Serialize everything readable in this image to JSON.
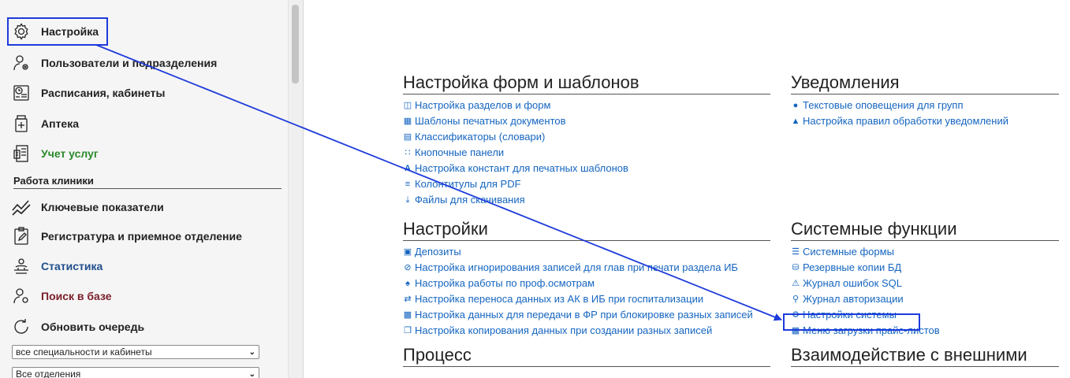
{
  "sidebar": {
    "items": [
      {
        "label": "Настройка"
      },
      {
        "label": "Пользователи и подразделения"
      },
      {
        "label": "Расписания, кабинеты"
      },
      {
        "label": "Аптека"
      },
      {
        "label": "Учет услуг"
      },
      {
        "label": "Ключевые показатели"
      },
      {
        "label": "Регистратура и приемное отделение"
      },
      {
        "label": "Статистика"
      },
      {
        "label": "Поиск в базе"
      },
      {
        "label": "Обновить очередь"
      }
    ],
    "section_heading": "Работа клиники",
    "select_specialty": "все специальности и кабинеты",
    "select_department": "Все отделения"
  },
  "main": {
    "forms": {
      "title": "Настройка форм и шаблонов",
      "links": [
        "Настройка разделов и форм",
        "Шаблоны печатных документов",
        "Классификаторы (словари)",
        "Кнопочные панели",
        "Настройка констант для печатных шаблонов",
        "Колонтитулы для PDF",
        "Файлы для скачивания"
      ]
    },
    "notifications": {
      "title": "Уведомления",
      "links": [
        "Текстовые оповещения для групп",
        "Настройка правил обработки уведомлений"
      ]
    },
    "settings": {
      "title": "Настройки",
      "links": [
        "Депозиты",
        "Настройка игнорирования записей для глав при печати раздела ИБ",
        "Настройка работы по проф.осмотрам",
        "Настройка переноса данных из АК в ИБ при госпитализации",
        "Настройка данных для передачи в ФР при блокировке разных записей",
        "Настройка копирования данных при создании разных записей"
      ]
    },
    "system": {
      "title": "Системные функции",
      "links": [
        "Системные формы",
        "Резервные копии БД",
        "Журнал ошибок SQL",
        "Журнал авторизации",
        "Настройки системы",
        "Меню загрузки прайс-листов"
      ]
    },
    "bottom_left_title": "Процесс",
    "bottom_right_title": "Взаимодействие с внешними"
  },
  "colors": {
    "link": "#1565c0",
    "annotation": "#1d3bdb",
    "green": "#2c8a2c"
  }
}
